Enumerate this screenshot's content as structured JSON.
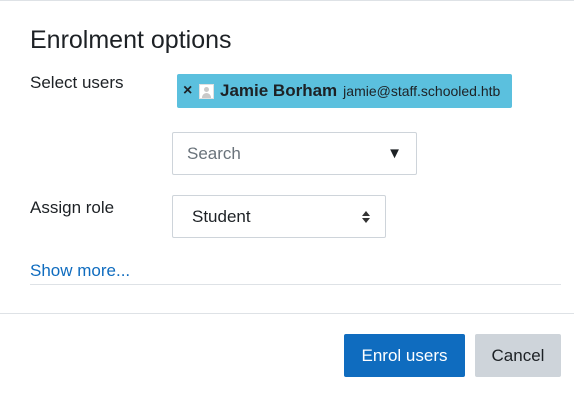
{
  "dialog": {
    "title": "Enrolment options"
  },
  "select_users": {
    "label": "Select users",
    "selected": [
      {
        "remove_icon": "×",
        "name": "Jamie Borham",
        "email": "jamie@staff.schooled.htb"
      }
    ],
    "search": {
      "placeholder": "Search",
      "caret": "▼"
    }
  },
  "assign_role": {
    "label": "Assign role",
    "value": "Student"
  },
  "show_more": "Show more...",
  "footer": {
    "enrol_label": "Enrol users",
    "cancel_label": "Cancel"
  },
  "colors": {
    "chip_bg": "#5bc0de",
    "primary": "#0f6cbf",
    "secondary": "#ced4da",
    "link": "#0f6cbf"
  },
  "icons": {
    "remove": "close-icon",
    "avatar": "user-avatar-icon",
    "dropdown": "caret-down-icon",
    "select": "updown-arrows-icon"
  }
}
